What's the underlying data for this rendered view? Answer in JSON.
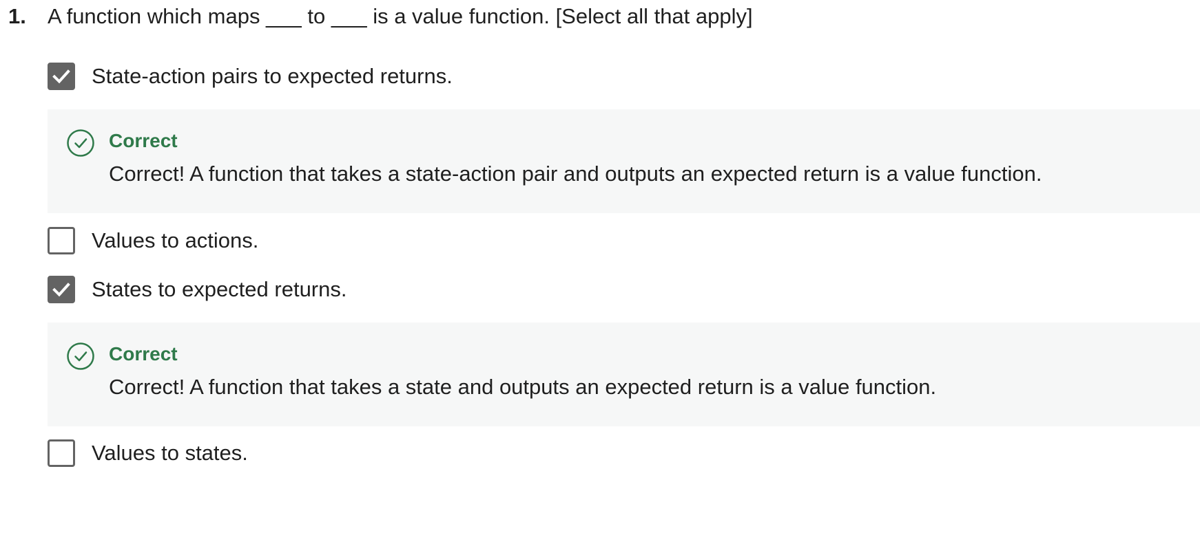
{
  "question": {
    "number": "1.",
    "text": "A function which maps ___ to ___ is a value function. [Select all that apply]"
  },
  "options": [
    {
      "label": "State-action pairs to expected returns.",
      "checked": true,
      "feedback": {
        "title": "Correct",
        "text": "Correct! A function that takes a state-action pair and outputs an expected return is a value function."
      }
    },
    {
      "label": "Values to actions.",
      "checked": false
    },
    {
      "label": "States to expected returns.",
      "checked": true,
      "feedback": {
        "title": "Correct",
        "text": "Correct! A function that takes a state and outputs an expected return is a value function."
      }
    },
    {
      "label": "Values to states.",
      "checked": false
    }
  ],
  "colors": {
    "checkbox": "#636363",
    "correct_green": "#2f7a4a",
    "feedback_bg": "#f6f7f7"
  },
  "icons": {
    "checked": "checkmark-icon",
    "feedback": "check-circle-icon"
  }
}
